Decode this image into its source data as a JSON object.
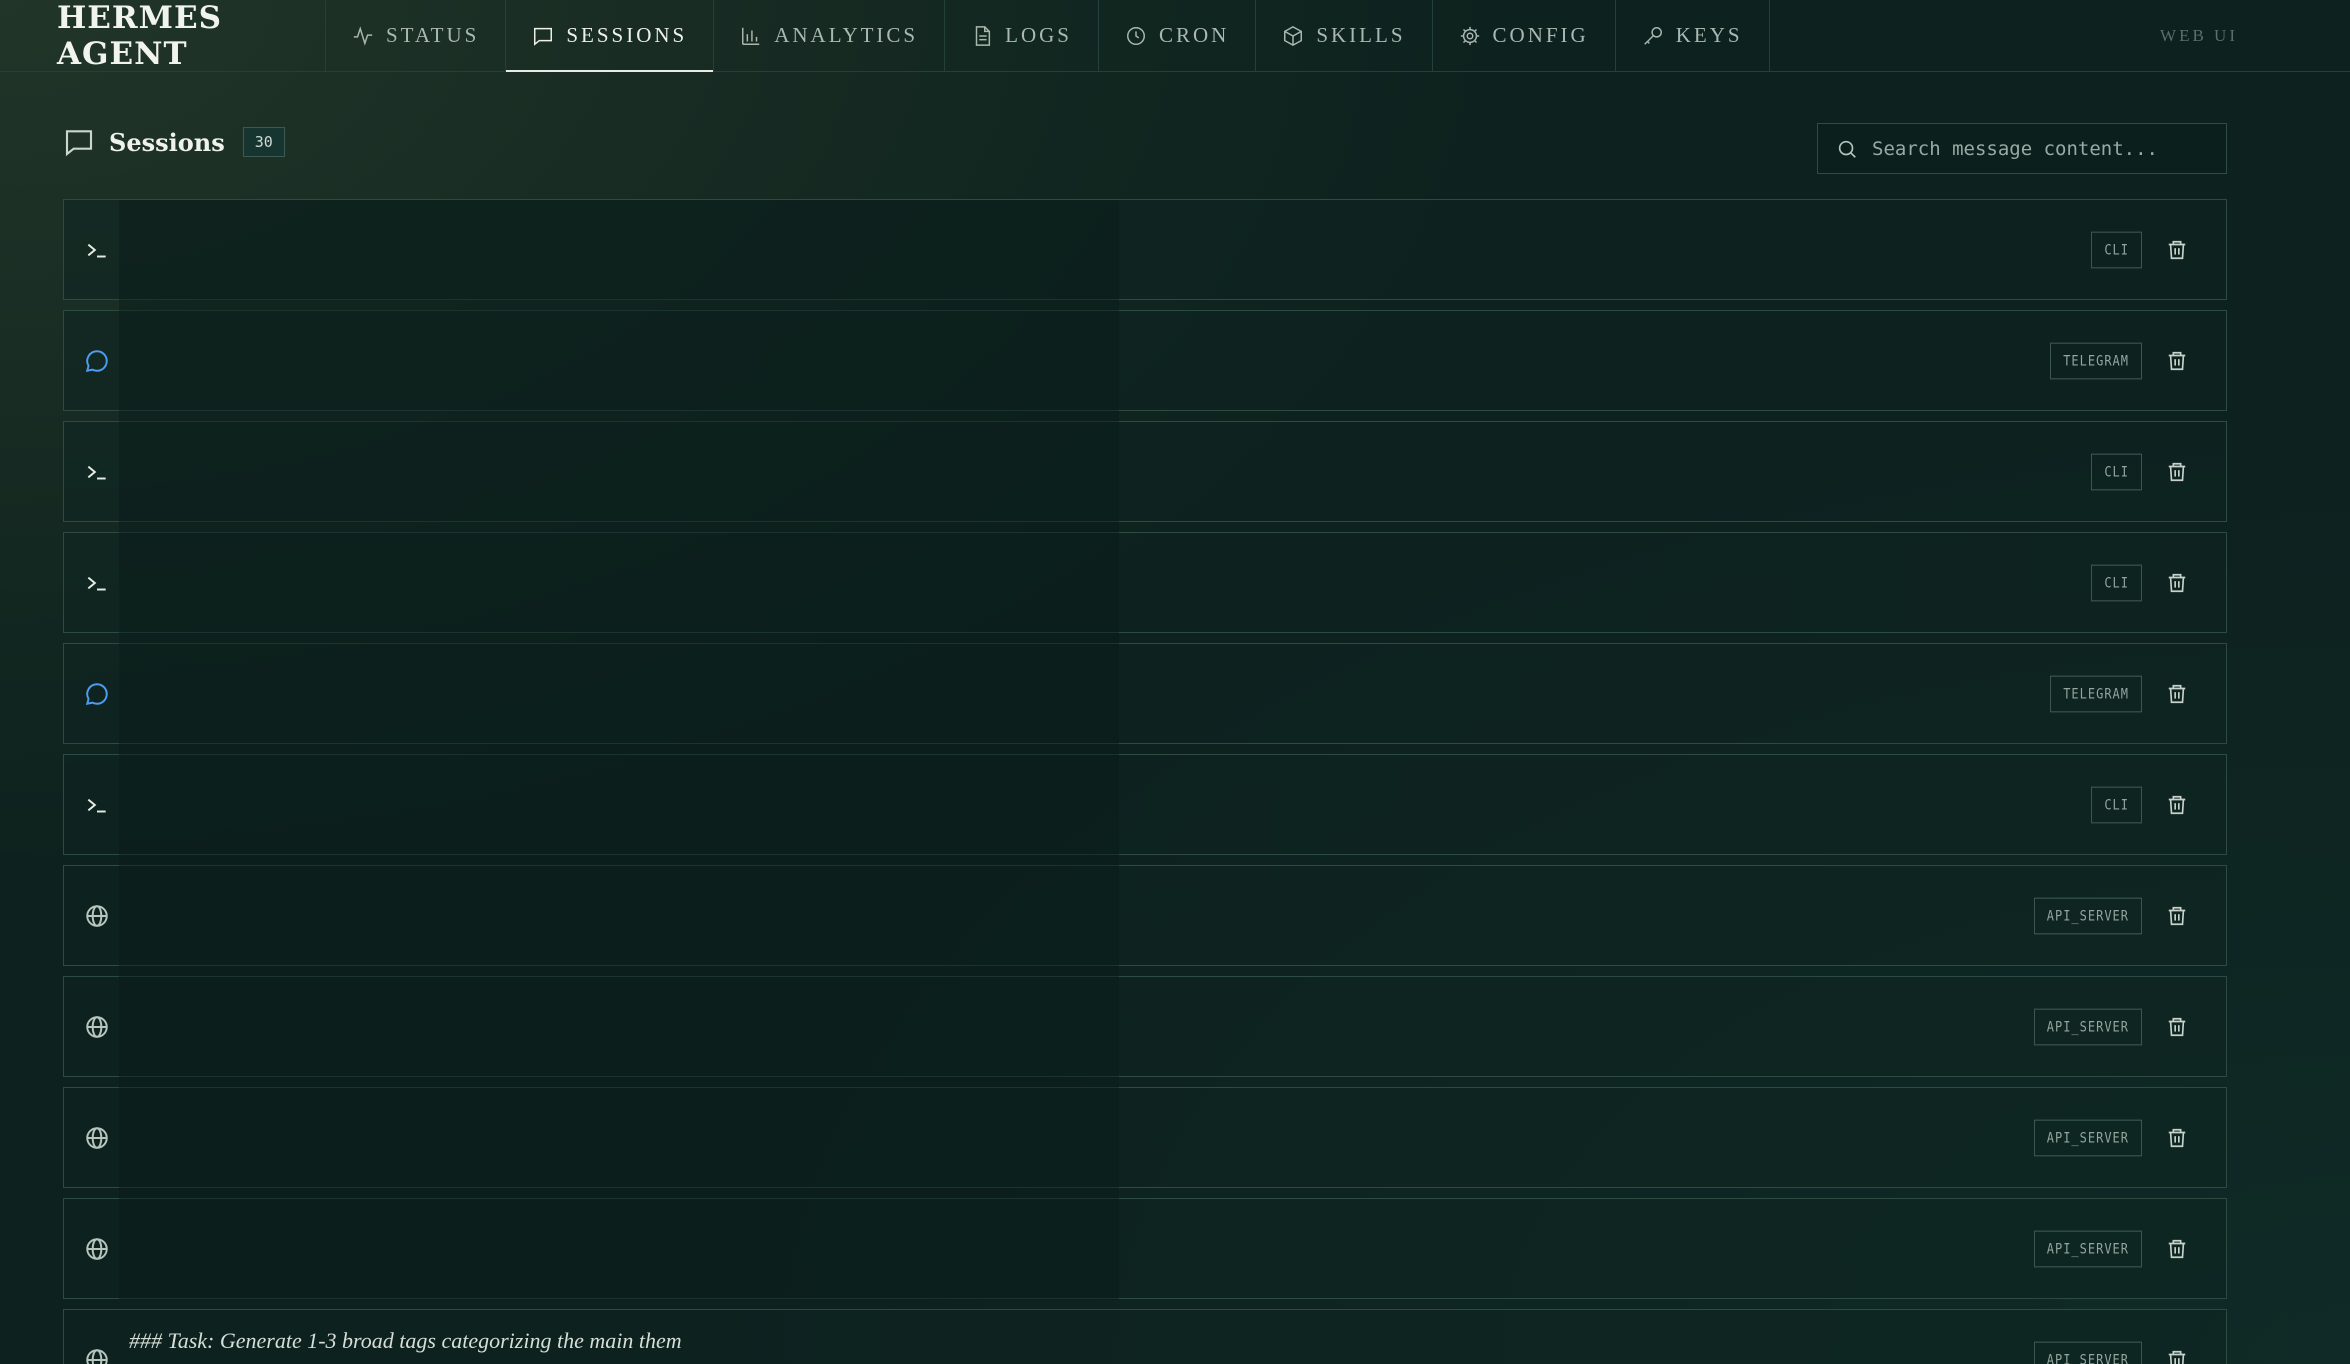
{
  "brand": "HERMES AGENT",
  "nav": [
    {
      "label": "STATUS",
      "icon": "activity-icon",
      "active": false
    },
    {
      "label": "SESSIONS",
      "icon": "message-square-icon",
      "active": true
    },
    {
      "label": "ANALYTICS",
      "icon": "bar-chart-icon",
      "active": false
    },
    {
      "label": "LOGS",
      "icon": "file-text-icon",
      "active": false
    },
    {
      "label": "CRON",
      "icon": "clock-icon",
      "active": false
    },
    {
      "label": "SKILLS",
      "icon": "package-icon",
      "active": false
    },
    {
      "label": "CONFIG",
      "icon": "gear-icon",
      "active": false
    },
    {
      "label": "KEYS",
      "icon": "key-icon",
      "active": false
    }
  ],
  "web_ui_label": "WEB UI",
  "sessions": {
    "title": "Sessions",
    "count": "30",
    "search_placeholder": "Search message content...",
    "rows": [
      {
        "source": "CLI",
        "icon": "terminal-icon",
        "blurred": true,
        "title": "",
        "meta": ""
      },
      {
        "source": "TELEGRAM",
        "icon": "chat-bubble-icon",
        "blurred": true,
        "title": "",
        "meta": ""
      },
      {
        "source": "CLI",
        "icon": "terminal-icon",
        "blurred": true,
        "title": "",
        "meta": ""
      },
      {
        "source": "CLI",
        "icon": "terminal-icon",
        "blurred": true,
        "title": "",
        "meta": ""
      },
      {
        "source": "TELEGRAM",
        "icon": "chat-bubble-icon",
        "blurred": true,
        "title": "",
        "meta": ""
      },
      {
        "source": "CLI",
        "icon": "terminal-icon",
        "blurred": true,
        "title": "",
        "meta": ""
      },
      {
        "source": "API_SERVER",
        "icon": "globe-icon",
        "blurred": true,
        "title": "",
        "meta": ""
      },
      {
        "source": "API_SERVER",
        "icon": "globe-icon",
        "blurred": true,
        "title": "",
        "meta": ""
      },
      {
        "source": "API_SERVER",
        "icon": "globe-icon",
        "blurred": true,
        "title": "",
        "meta": ""
      },
      {
        "source": "API_SERVER",
        "icon": "globe-icon",
        "blurred": true,
        "title": "",
        "meta": ""
      },
      {
        "source": "API_SERVER",
        "icon": "globe-icon",
        "blurred": false,
        "title": "### Task: Generate 1-3 broad tags categorizing the main them",
        "meta": ""
      }
    ]
  }
}
